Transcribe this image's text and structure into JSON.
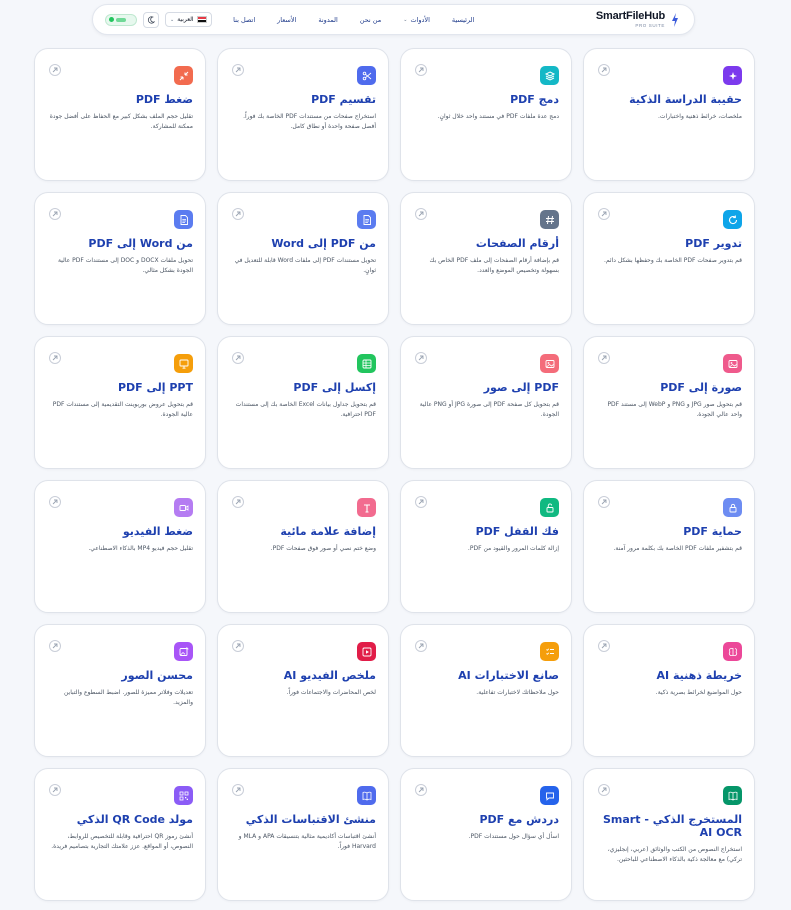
{
  "header": {
    "brand_name": "SmartFileHub",
    "brand_sub": "PRO SUITE",
    "nav": [
      {
        "label": "الرئيسية"
      },
      {
        "label": "الأدوات",
        "has_dropdown": true
      },
      {
        "label": "من نحن"
      },
      {
        "label": "المدونة"
      },
      {
        "label": "الأسعار"
      },
      {
        "label": "اتصل بنا"
      }
    ],
    "language": "العربية"
  },
  "tools": [
    {
      "title": "حقيبة الدراسة الذكية",
      "desc": "ملخصات، خرائط ذهنية واختبارات.",
      "icon": "sparkles-icon",
      "color": "#7c3aed"
    },
    {
      "title": "دمج PDF",
      "desc": "دمج عدة ملفات PDF في مستند واحد خلال ثوانٍ.",
      "icon": "layers-icon",
      "color": "#14b8c6"
    },
    {
      "title": "تقسيم PDF",
      "desc": "استخراج صفحات من مستندات PDF الخاصة بك فوراً. أفصل صفحة واحدة أو نطاق كامل.",
      "icon": "scissors-icon",
      "color": "#4f6bed"
    },
    {
      "title": "ضغط PDF",
      "desc": "تقليل حجم الملف بشكل كبير مع الحفاظ على أفضل جودة ممكنة للمشاركة.",
      "icon": "compress-icon",
      "color": "#f26b4f"
    },
    {
      "title": "تدوير PDF",
      "desc": "قم بتدوير صفحات PDF الخاصة بك وحفظها بشكل دائم.",
      "icon": "rotate-icon",
      "color": "#0ea5e9"
    },
    {
      "title": "أرقام الصفحات",
      "desc": "قم بإضافة أرقام الصفحات إلى ملف PDF الخاص بك بسهولة وتخصيص الموضع والعدد.",
      "icon": "hash-icon",
      "color": "#64748b"
    },
    {
      "title": "من PDF إلى Word",
      "desc": "تحويل مستندات PDF إلى ملفات Word قابلة للتعديل في ثوانٍ.",
      "icon": "file-word-icon",
      "color": "#5b7cf0"
    },
    {
      "title": "من Word إلى PDF",
      "desc": "تحويل ملفات DOCX و DOC إلى مستندات PDF عالية الجودة بشكل مثالي.",
      "icon": "file-text-icon",
      "color": "#5b7cf0"
    },
    {
      "title": "صورة إلى PDF",
      "desc": "قم بتحويل صور JPG و PNG و WebP إلى مستند PDF واحد عالي الجودة.",
      "icon": "image-icon",
      "color": "#ef5a8c"
    },
    {
      "title": "PDF إلى صور",
      "desc": "قم بتحويل كل صفحة PDF إلى صورة JPG أو PNG عالية الجودة.",
      "icon": "image-file-icon",
      "color": "#f46c7a"
    },
    {
      "title": "إكسل إلى PDF",
      "desc": "قم بتحويل جداول بيانات Excel الخاصة بك إلى مستندات PDF احترافية.",
      "icon": "table-icon",
      "color": "#22c55e"
    },
    {
      "title": "PPT إلى PDF",
      "desc": "قم بتحويل عروض بوربوينت التقديمية إلى مستندات PDF عالية الجودة.",
      "icon": "presentation-icon",
      "color": "#f59e0b"
    },
    {
      "title": "حماية PDF",
      "desc": "قم بتشفير ملفات PDF الخاصة بك بكلمة مرور آمنة.",
      "icon": "lock-icon",
      "color": "#6d8cf2"
    },
    {
      "title": "فك القفل PDF",
      "desc": "إزالة كلمات المرور والقيود من PDF.",
      "icon": "unlock-icon",
      "color": "#10b981"
    },
    {
      "title": "إضافة علامة مائية",
      "desc": "وضع ختم نصي أو صور فوق صفحات PDF.",
      "icon": "text-icon",
      "color": "#f26b8f"
    },
    {
      "title": "ضغط الفيديو",
      "desc": "تقليل حجم فيديو MP4 بالذكاء الاصطناعي.",
      "icon": "video-icon",
      "color": "#b57cf2"
    },
    {
      "title": "خريطة ذهنية AI",
      "desc": "حول المواضيع لخرائط بصرية ذكية.",
      "icon": "brain-icon",
      "color": "#ec4899"
    },
    {
      "title": "صانع الاختبارات AI",
      "desc": "حول ملاحظاتك لاختبارات تفاعلية.",
      "icon": "checklist-icon",
      "color": "#f59e0b"
    },
    {
      "title": "ملخص الفيديو AI",
      "desc": "لخص المحاضرات والاجتماعات فوراً.",
      "icon": "video-summary-icon",
      "color": "#e11d48"
    },
    {
      "title": "محسن الصور",
      "desc": "تعديلات وفلاتر مميزة للصور. اضبط السطوع والتباين والمزيد.",
      "icon": "image-edit-icon",
      "color": "#a855f7"
    },
    {
      "title": "المستخرج الذكي - Smart AI OCR",
      "desc": "استخراج النصوص من الكتب والوثائق (عربي، إنجليزي، تركي) مع معالجة ذكية بالذكاء الاصطناعي للباحثين.",
      "icon": "book-icon",
      "color": "#059669"
    },
    {
      "title": "دردش مع PDF",
      "desc": "اسأل أي سؤال حول مستندات PDF.",
      "icon": "chat-icon",
      "color": "#2563eb"
    },
    {
      "title": "منشئ الاقتباسات الذكي",
      "desc": "أنشئ اقتباسات أكاديمية مثالية بتنسيقات APA و MLA و Harvard فوراً.",
      "icon": "book-open-icon",
      "color": "#4f6bed"
    },
    {
      "title": "مولد QR Code الذكي",
      "desc": "أنشئ رموز QR احترافية وقابلة للتخصيص للروابط، النصوص، أو المواقع. عزز علامتك التجارية بتصاميم فريدة.",
      "icon": "qr-icon",
      "color": "#8b5cf6"
    }
  ]
}
